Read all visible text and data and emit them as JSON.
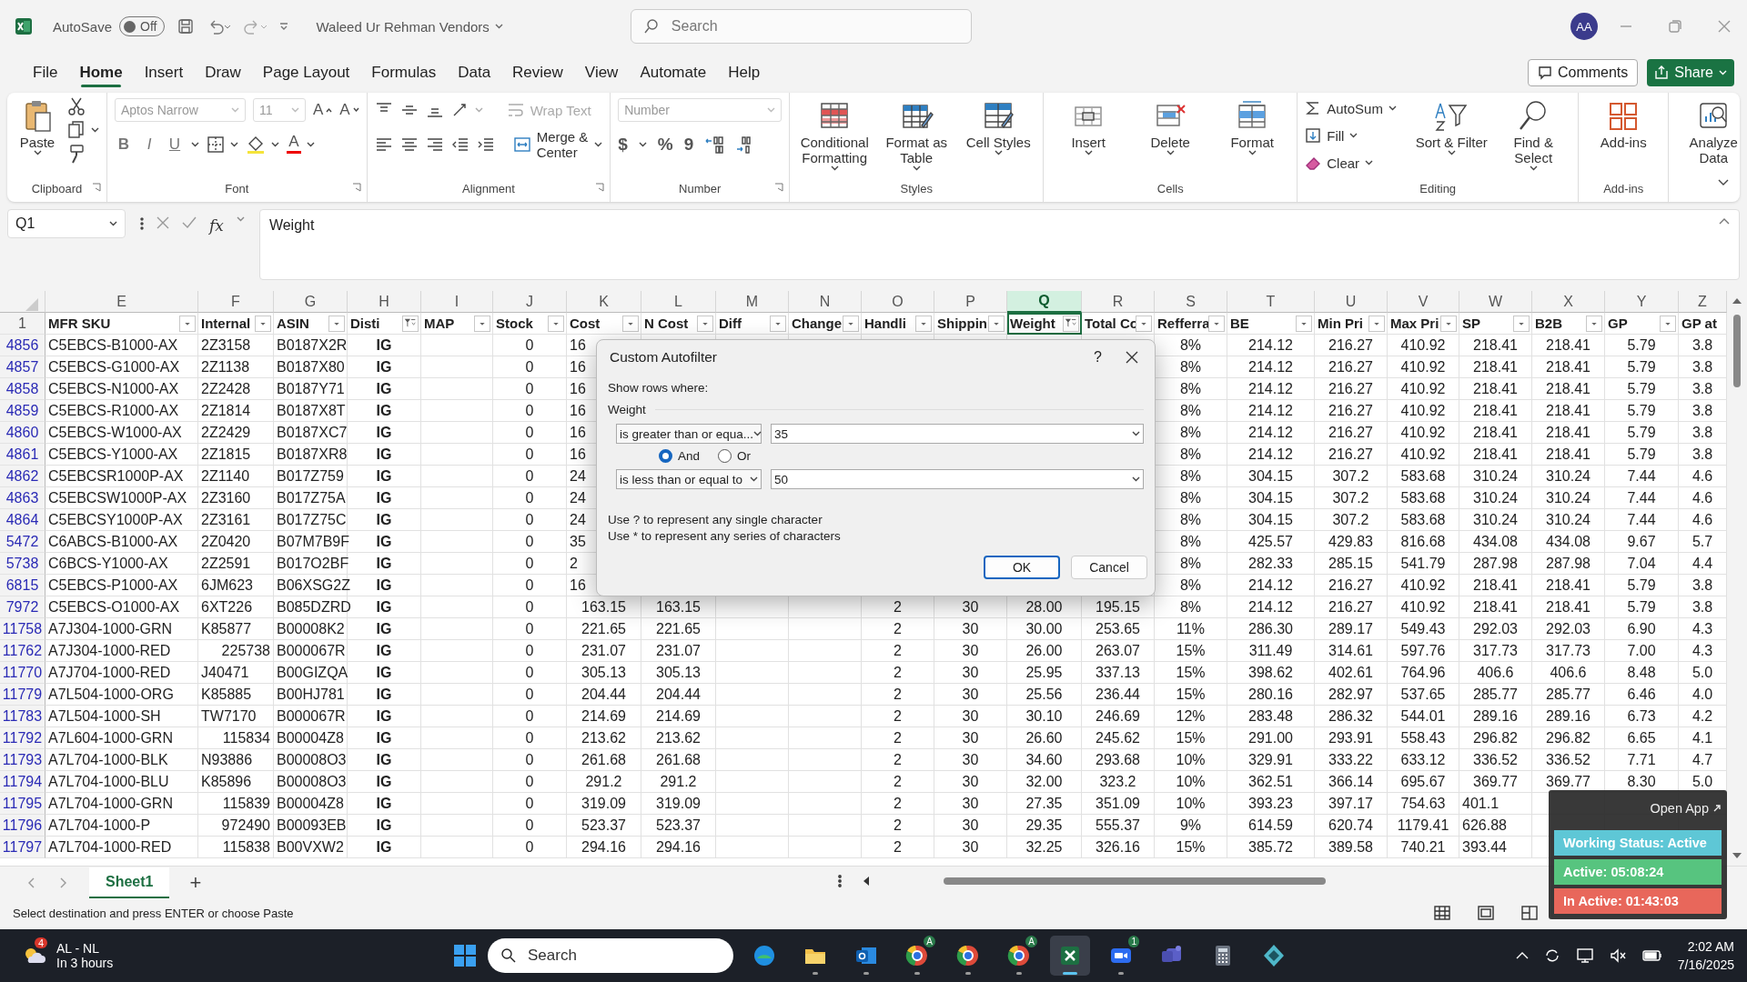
{
  "title_bar": {
    "autosave_label": "AutoSave",
    "autosave": {
      "on": false,
      "label": "Off"
    },
    "document": "Waleed Ur Rehman Vendors",
    "search": {
      "placeholder": "Search"
    },
    "avatar": "AA"
  },
  "menu": {
    "tabs": [
      {
        "label": "File",
        "selected": false
      },
      {
        "label": "Home",
        "selected": true
      },
      {
        "label": "Insert",
        "selected": false
      },
      {
        "label": "Draw",
        "selected": false
      },
      {
        "label": "Page Layout",
        "selected": false
      },
      {
        "label": "Formulas",
        "selected": false
      },
      {
        "label": "Data",
        "selected": false
      },
      {
        "label": "Review",
        "selected": false
      },
      {
        "label": "View",
        "selected": false
      },
      {
        "label": "Automate",
        "selected": false
      },
      {
        "label": "Help",
        "selected": false
      }
    ],
    "comments": "Comments",
    "share": "Share"
  },
  "ribbon": {
    "groups": [
      {
        "kind": "clipboard",
        "label": "Clipboard",
        "paste": "Paste"
      },
      {
        "kind": "font",
        "label": "Font",
        "font_name": {
          "value": "Aptos Narrow",
          "disabled": true
        },
        "font_size": {
          "value": "11",
          "disabled": true
        },
        "size_buttons": [
          "A",
          "A"
        ],
        "styles": [
          "B",
          "I",
          "U"
        ],
        "color_button": "A"
      },
      {
        "kind": "alignment",
        "label": "Alignment",
        "wrap": {
          "label": "Wrap Text",
          "disabled": true
        },
        "merge": {
          "label": "Merge & Center",
          "disabled": false
        }
      },
      {
        "kind": "number",
        "label": "Number",
        "format": {
          "value": "Number",
          "disabled": true
        },
        "glyphs": [
          "$",
          "%",
          "9"
        ]
      },
      {
        "kind": "large",
        "label": "Styles",
        "buttons": [
          {
            "label": "Conditional Formatting",
            "dropdown": true
          },
          {
            "label": "Format as Table",
            "dropdown": true
          },
          {
            "label": "Cell Styles",
            "dropdown": true
          }
        ]
      },
      {
        "kind": "large",
        "label": "Cells",
        "buttons": [
          {
            "label": "Insert",
            "dropdown": true
          },
          {
            "label": "Delete",
            "dropdown": true
          },
          {
            "label": "Format",
            "dropdown": true
          }
        ]
      },
      {
        "kind": "editing",
        "label": "Editing",
        "small": [
          {
            "label": "AutoSum",
            "dropdown": true
          },
          {
            "label": "Fill",
            "dropdown": true
          },
          {
            "label": "Clear",
            "dropdown": true
          }
        ],
        "buttons": [
          {
            "label": "Sort & Filter",
            "dropdown": true
          },
          {
            "label": "Find & Select",
            "dropdown": true
          }
        ]
      },
      {
        "kind": "large",
        "label": "Add-ins",
        "buttons": [
          {
            "label": "Add-ins",
            "dropdown": false
          }
        ]
      },
      {
        "kind": "large",
        "buttons": [
          {
            "label": "Analyze Data",
            "dropdown": false
          }
        ]
      }
    ]
  },
  "formula_bar": {
    "name_box": "Q1",
    "fx": "fx",
    "formula": "Weight"
  },
  "grid": {
    "header_row": "1",
    "columns": [
      {
        "letter": "E",
        "header": "MFR SKU",
        "filtered": false,
        "selected": false
      },
      {
        "letter": "F",
        "header": "Internal",
        "filtered": false,
        "selected": false
      },
      {
        "letter": "G",
        "header": "ASIN",
        "filtered": false,
        "selected": false
      },
      {
        "letter": "H",
        "header": "Disti",
        "filtered": true,
        "selected": false
      },
      {
        "letter": "I",
        "header": "MAP",
        "filtered": false,
        "selected": false
      },
      {
        "letter": "J",
        "header": "Stock",
        "filtered": false,
        "selected": false
      },
      {
        "letter": "K",
        "header": "Cost",
        "filtered": false,
        "selected": false
      },
      {
        "letter": "L",
        "header": "N Cost",
        "filtered": false,
        "selected": false
      },
      {
        "letter": "M",
        "header": "Diff",
        "filtered": false,
        "selected": false
      },
      {
        "letter": "N",
        "header": "Change",
        "filtered": false,
        "selected": false
      },
      {
        "letter": "O",
        "header": "Handli",
        "filtered": false,
        "selected": false
      },
      {
        "letter": "P",
        "header": "Shippin",
        "filtered": false,
        "selected": false
      },
      {
        "letter": "Q",
        "header": "Weight",
        "filtered": true,
        "selected": true
      },
      {
        "letter": "R",
        "header": "Total Co",
        "filtered": false,
        "selected": false
      },
      {
        "letter": "S",
        "header": "Refferra",
        "filtered": false,
        "selected": false
      },
      {
        "letter": "T",
        "header": "BE",
        "filtered": false,
        "selected": false
      },
      {
        "letter": "U",
        "header": "Min Pri",
        "filtered": false,
        "selected": false
      },
      {
        "letter": "V",
        "header": "Max Pri",
        "filtered": false,
        "selected": false
      },
      {
        "letter": "W",
        "header": "SP",
        "filtered": false,
        "selected": false
      },
      {
        "letter": "X",
        "header": "B2B",
        "filtered": false,
        "selected": false
      },
      {
        "letter": "Y",
        "header": "GP",
        "filtered": false,
        "selected": false
      },
      {
        "letter": "Z",
        "header": "GP at",
        "selected": false
      }
    ],
    "rows": [
      {
        "number": "4856",
        "cells": [
          "C5EBCS-B1000-AX",
          "2Z3158",
          "B0187X2R",
          "IG",
          null,
          "0",
          "16",
          null,
          null,
          null,
          null,
          null,
          null,
          null,
          "8%",
          "214.12",
          "216.27",
          "410.92",
          "218.41",
          "218.41",
          "5.79",
          "3.8"
        ]
      },
      {
        "number": "4857",
        "cells": [
          "C5EBCS-G1000-AX",
          "2Z1138",
          "B0187X80",
          "IG",
          null,
          "0",
          "16",
          null,
          null,
          null,
          null,
          null,
          null,
          null,
          "8%",
          "214.12",
          "216.27",
          "410.92",
          "218.41",
          "218.41",
          "5.79",
          "3.8"
        ]
      },
      {
        "number": "4858",
        "cells": [
          "C5EBCS-N1000-AX",
          "2Z2428",
          "B0187Y71",
          "IG",
          null,
          "0",
          "16",
          null,
          null,
          null,
          null,
          null,
          null,
          null,
          "8%",
          "214.12",
          "216.27",
          "410.92",
          "218.41",
          "218.41",
          "5.79",
          "3.8"
        ]
      },
      {
        "number": "4859",
        "cells": [
          "C5EBCS-R1000-AX",
          "2Z1814",
          "B0187X8T",
          "IG",
          null,
          "0",
          "16",
          null,
          null,
          null,
          null,
          null,
          null,
          null,
          "8%",
          "214.12",
          "216.27",
          "410.92",
          "218.41",
          "218.41",
          "5.79",
          "3.8"
        ]
      },
      {
        "number": "4860",
        "cells": [
          "C5EBCS-W1000-AX",
          "2Z2429",
          "B0187XC7",
          "IG",
          null,
          "0",
          "16",
          null,
          null,
          null,
          null,
          null,
          null,
          null,
          "8%",
          "214.12",
          "216.27",
          "410.92",
          "218.41",
          "218.41",
          "5.79",
          "3.8"
        ]
      },
      {
        "number": "4861",
        "cells": [
          "C5EBCS-Y1000-AX",
          "2Z1815",
          "B0187XR8",
          "IG",
          null,
          "0",
          "16",
          null,
          null,
          null,
          null,
          null,
          null,
          null,
          "8%",
          "214.12",
          "216.27",
          "410.92",
          "218.41",
          "218.41",
          "5.79",
          "3.8"
        ]
      },
      {
        "number": "4862",
        "cells": [
          "C5EBCSR1000P-AX",
          "2Z1140",
          "B017Z759",
          "IG",
          null,
          "0",
          "24",
          null,
          null,
          null,
          null,
          null,
          null,
          null,
          "8%",
          "304.15",
          "307.2",
          "583.68",
          "310.24",
          "310.24",
          "7.44",
          "4.6"
        ]
      },
      {
        "number": "4863",
        "cells": [
          "C5EBCSW1000P-AX",
          "2Z3160",
          "B017Z75A",
          "IG",
          null,
          "0",
          "24",
          null,
          null,
          null,
          null,
          null,
          null,
          null,
          "8%",
          "304.15",
          "307.2",
          "583.68",
          "310.24",
          "310.24",
          "7.44",
          "4.6"
        ]
      },
      {
        "number": "4864",
        "cells": [
          "C5EBCSY1000P-AX",
          "2Z3161",
          "B017Z75C",
          "IG",
          null,
          "0",
          "24",
          null,
          null,
          null,
          null,
          null,
          null,
          null,
          "8%",
          "304.15",
          "307.2",
          "583.68",
          "310.24",
          "310.24",
          "7.44",
          "4.6"
        ]
      },
      {
        "number": "5472",
        "cells": [
          "C6ABCS-B1000-AX",
          "2Z0420",
          "B07M7B9F",
          "IG",
          null,
          "0",
          "35",
          null,
          null,
          null,
          null,
          null,
          null,
          null,
          "8%",
          "425.57",
          "429.83",
          "816.68",
          "434.08",
          "434.08",
          "9.67",
          "5.7"
        ]
      },
      {
        "number": "5738",
        "cells": [
          "C6BCS-Y1000-AX",
          "2Z2591",
          "B017O2BF",
          "IG",
          null,
          "0",
          "2",
          null,
          null,
          null,
          null,
          null,
          null,
          null,
          "8%",
          "282.33",
          "285.15",
          "541.79",
          "287.98",
          "287.98",
          "7.04",
          "4.4"
        ]
      },
      {
        "number": "6815",
        "cells": [
          "C5EBCS-P1000-AX",
          "6JM623",
          "B06XSG2Z",
          "IG",
          null,
          "0",
          "16",
          null,
          null,
          null,
          null,
          null,
          null,
          null,
          "8%",
          "214.12",
          "216.27",
          "410.92",
          "218.41",
          "218.41",
          "5.79",
          "3.8"
        ]
      },
      {
        "number": "7972",
        "cells": [
          "C5EBCS-O1000-AX",
          "6XT226",
          "B085DZRD",
          "IG",
          null,
          "0",
          "163.15",
          "163.15",
          null,
          null,
          "2",
          "30",
          "28.00",
          "195.15",
          "8%",
          "214.12",
          "216.27",
          "410.92",
          "218.41",
          "218.41",
          "5.79",
          "3.8"
        ]
      },
      {
        "number": "11758",
        "cells": [
          "A7J304-1000-GRN",
          "K85877",
          "B00008K2",
          "IG",
          null,
          "0",
          "221.65",
          "221.65",
          null,
          null,
          "2",
          "30",
          "30.00",
          "253.65",
          "11%",
          "286.30",
          "289.17",
          "549.43",
          "292.03",
          "292.03",
          "6.90",
          "4.3"
        ]
      },
      {
        "number": "11762",
        "cells": [
          "A7J304-1000-RED",
          "225738",
          "B000067R",
          "IG",
          null,
          "0",
          "231.07",
          "231.07",
          null,
          null,
          "2",
          "30",
          "26.00",
          "263.07",
          "15%",
          "311.49",
          "314.61",
          "597.76",
          "317.73",
          "317.73",
          "7.00",
          "4.3"
        ]
      },
      {
        "number": "11770",
        "cells": [
          "A7J704-1000-RED",
          "J40471",
          "B00GIZQA",
          "IG",
          null,
          "0",
          "305.13",
          "305.13",
          null,
          null,
          "2",
          "30",
          "25.95",
          "337.13",
          "15%",
          "398.62",
          "402.61",
          "764.96",
          "406.6",
          "406.6",
          "8.48",
          "5.0"
        ]
      },
      {
        "number": "11779",
        "cells": [
          "A7L504-1000-ORG",
          "K85885",
          "B00HJ781",
          "IG",
          null,
          "0",
          "204.44",
          "204.44",
          null,
          null,
          "2",
          "30",
          "25.56",
          "236.44",
          "15%",
          "280.16",
          "282.97",
          "537.65",
          "285.77",
          "285.77",
          "6.46",
          "4.0"
        ]
      },
      {
        "number": "11783",
        "cells": [
          "A7L504-1000-SH",
          "TW7170",
          "B000067R",
          "IG",
          null,
          "0",
          "214.69",
          "214.69",
          null,
          null,
          "2",
          "30",
          "30.10",
          "246.69",
          "12%",
          "283.48",
          "286.32",
          "544.01",
          "289.16",
          "289.16",
          "6.73",
          "4.2"
        ]
      },
      {
        "number": "11792",
        "cells": [
          "A7L604-1000-GRN",
          "115834",
          "B00004Z8",
          "IG",
          null,
          "0",
          "213.62",
          "213.62",
          null,
          null,
          "2",
          "30",
          "26.60",
          "245.62",
          "15%",
          "291.00",
          "293.91",
          "558.43",
          "296.82",
          "296.82",
          "6.65",
          "4.1"
        ]
      },
      {
        "number": "11793",
        "cells": [
          "A7L704-1000-BLK",
          "N93886",
          "B00008O3",
          "IG",
          null,
          "0",
          "261.68",
          "261.68",
          null,
          null,
          "2",
          "30",
          "34.60",
          "293.68",
          "10%",
          "329.91",
          "333.22",
          "633.12",
          "336.52",
          "336.52",
          "7.71",
          "4.7"
        ]
      },
      {
        "number": "11794",
        "cells": [
          "A7L704-1000-BLU",
          "K85896",
          "B00008O3",
          "IG",
          null,
          "0",
          "291.2",
          "291.2",
          null,
          null,
          "2",
          "30",
          "32.00",
          "323.2",
          "10%",
          "362.51",
          "366.14",
          "695.67",
          "369.77",
          "369.77",
          "8.30",
          "5.0"
        ]
      },
      {
        "number": "11795",
        "cells": [
          "A7L704-1000-GRN",
          "115839",
          "B00004Z8",
          "IG",
          null,
          "0",
          "319.09",
          "319.09",
          null,
          null,
          "2",
          "30",
          "27.35",
          "351.09",
          "10%",
          "393.23",
          "397.17",
          "754.63",
          "401.1",
          null,
          null,
          null
        ]
      },
      {
        "number": "11796",
        "cells": [
          "A7L704-1000-P",
          "972490",
          "B00093EB",
          "IG",
          null,
          "0",
          "523.37",
          "523.37",
          null,
          null,
          "2",
          "30",
          "29.35",
          "555.37",
          "9%",
          "614.59",
          "620.74",
          "1179.41",
          "626.88",
          null,
          null,
          null
        ]
      },
      {
        "number": "11797",
        "cells": [
          "A7L704-1000-RED",
          "115838",
          "B00VXW2",
          "IG",
          null,
          "0",
          "294.16",
          "294.16",
          null,
          null,
          "2",
          "30",
          "32.25",
          "326.16",
          "15%",
          "385.72",
          "389.58",
          "740.21",
          "393.44",
          null,
          null,
          null
        ]
      }
    ]
  },
  "dialog": {
    "title": "Custom Autofilter",
    "help": "?",
    "show_rows": "Show rows where:",
    "field": "Weight",
    "conditions": [
      {
        "operator": "is greater than or equa...",
        "value": "35"
      },
      {
        "operator": "is less than or equal to",
        "value": "50"
      }
    ],
    "join": [
      {
        "label": "And",
        "selected": true
      },
      {
        "label": "Or",
        "selected": false
      }
    ],
    "hints": [
      "Use ? to represent any single character",
      "Use * to represent any series of characters"
    ],
    "buttons": [
      {
        "label": "OK",
        "default": true
      },
      {
        "label": "Cancel",
        "default": false
      }
    ]
  },
  "sheets": {
    "tabs": [
      {
        "label": "Sheet1",
        "selected": true
      }
    ],
    "add": "+"
  },
  "status_bar": {
    "message": "Select destination and press ENTER or choose Paste"
  },
  "tracker": {
    "open_app": "Open App",
    "status": "Working Status: Active",
    "active": "Active: 05:08:24",
    "inactive": "In Active: 01:43:03"
  },
  "taskbar": {
    "weather": {
      "badge": "4",
      "title": "AL - NL",
      "subtitle": "In 3 hours"
    },
    "search": {
      "placeholder": "Search"
    },
    "apps": [
      {
        "kind": "edge",
        "running": false,
        "active": false
      },
      {
        "kind": "folder",
        "running": true,
        "active": false
      },
      {
        "kind": "mail",
        "running": true,
        "active": false
      },
      {
        "kind": "browser",
        "badge": "A",
        "running": true,
        "active": false
      },
      {
        "kind": "browser",
        "running": true,
        "active": false
      },
      {
        "kind": "browser",
        "badge": "A",
        "running": true,
        "active": false
      },
      {
        "kind": "sheet",
        "running": true,
        "active": true
      },
      {
        "kind": "video",
        "badge": "1",
        "running": true,
        "active": false
      },
      {
        "kind": "chat",
        "running": false,
        "active": false
      },
      {
        "kind": "calculator",
        "running": false,
        "active": false
      },
      {
        "kind": "diamond",
        "running": false,
        "active": false
      }
    ],
    "clock": {
      "time": "2:02 AM",
      "date": "7/16/2025"
    }
  }
}
